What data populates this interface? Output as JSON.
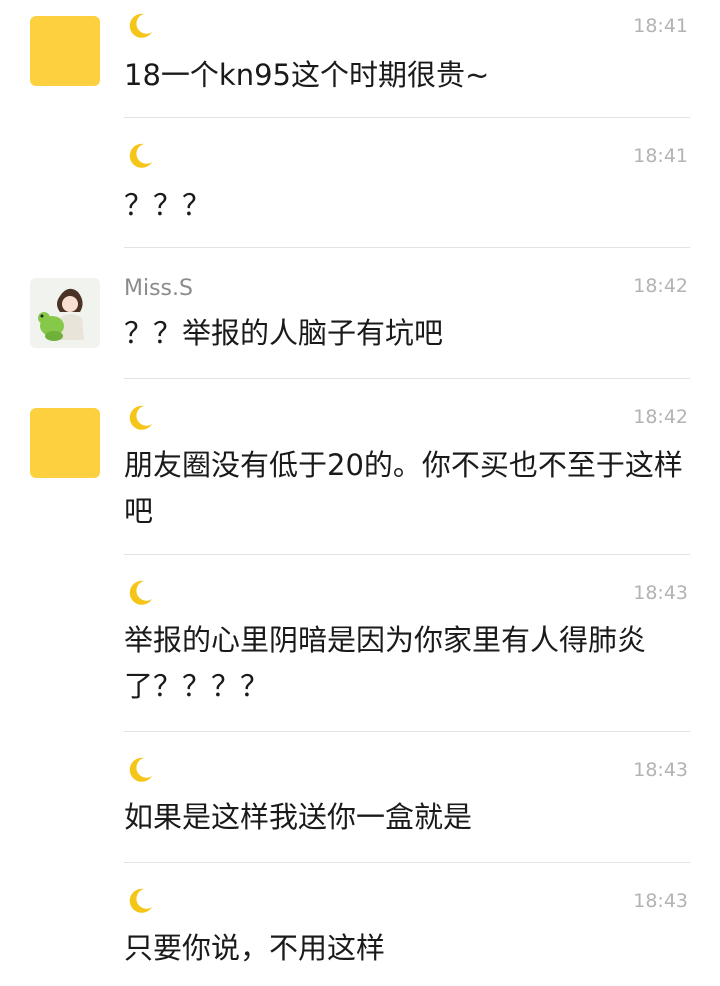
{
  "messages": [
    {
      "sender": "moon",
      "time": "18:41",
      "text": "18一个kn95这个时期很贵~"
    },
    {
      "sender": "moon",
      "time": "18:41",
      "text": "？？？"
    },
    {
      "sender": "Miss.S",
      "time": "18:42",
      "text": "？？举报的人脑子有坑吧"
    },
    {
      "sender": "moon",
      "time": "18:42",
      "text": "朋友圈没有低于20的。你不买也不至于这样吧"
    },
    {
      "sender": "moon",
      "time": "18:43",
      "text": "举报的心里阴暗是因为你家里有人得肺炎了？？？？"
    },
    {
      "sender": "moon",
      "time": "18:43",
      "text": "如果是这样我送你一盒就是"
    },
    {
      "sender": "moon",
      "time": "18:43",
      "text": "只要你说，不用这样"
    }
  ],
  "colors": {
    "avatar_yellow": "#fdd040",
    "moon": "#f5c518",
    "timestamp": "#b3b3b3",
    "divider": "#e3e3e3"
  }
}
